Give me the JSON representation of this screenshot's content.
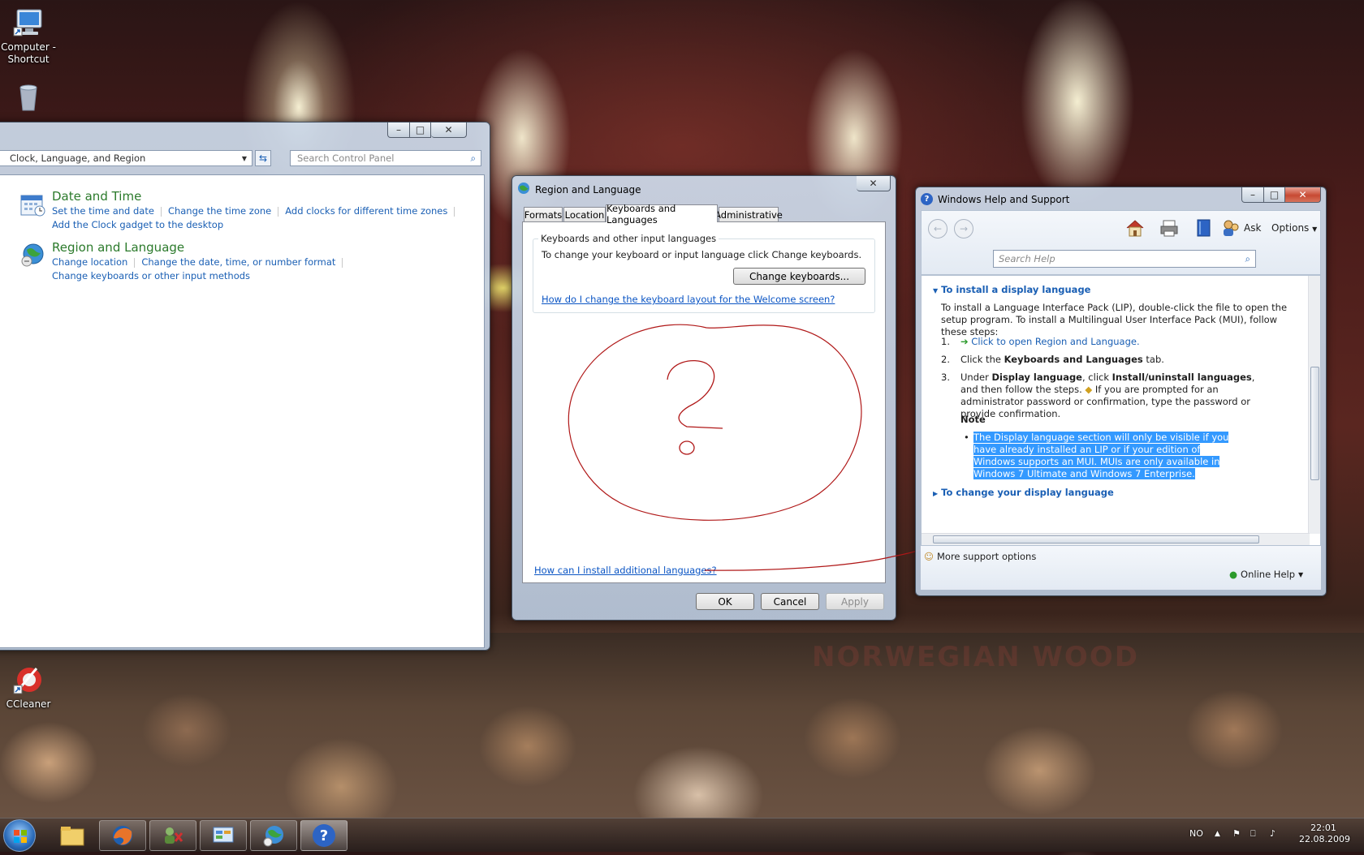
{
  "desktop": {
    "icons": [
      {
        "label_line1": "Computer -",
        "label_line2": "Shortcut"
      },
      {
        "label": "Recycle Bin"
      },
      {
        "label": "CCleaner"
      }
    ],
    "stage_text": "NORWEGIAN WOOD"
  },
  "control_panel": {
    "address": "Clock, Language, and Region",
    "search_placeholder": "Search Control Panel",
    "sections": [
      {
        "title": "Date and Time",
        "links_row1": [
          "Set the time and date",
          "Change the time zone",
          "Add clocks for different time zones"
        ],
        "links_row2": [
          "Add the Clock gadget to the desktop"
        ]
      },
      {
        "title": "Region and Language",
        "links_row1": [
          "Change location",
          "Change the date, time, or number format"
        ],
        "links_row2": [
          "Change keyboards or other input methods"
        ]
      }
    ]
  },
  "region_dialog": {
    "title": "Region and Language",
    "tabs": [
      "Formats",
      "Location",
      "Keyboards and Languages",
      "Administrative"
    ],
    "active_tab": "Keyboards and Languages",
    "group_title": "Keyboards and other input languages",
    "group_text": "To change your keyboard or input language click Change keyboards.",
    "change_button": "Change keyboards...",
    "welcome_link": "How do I change the keyboard layout for the Welcome screen?",
    "install_link": "How can I install additional languages?",
    "annotation": "?",
    "ok": "OK",
    "cancel": "Cancel",
    "apply": "Apply"
  },
  "help_window": {
    "title": "Windows Help and Support",
    "ask": "Ask",
    "options": "Options",
    "search_placeholder": "Search Help",
    "section1_title": "To install a display language",
    "intro": "To install a Language Interface Pack (LIP), double-click the file to open the setup program. To install a Multilingual User Interface Pack (MUI), follow these steps:",
    "steps": [
      {
        "num": "1.",
        "text": "Click to open Region and Language."
      },
      {
        "num": "2.",
        "pre": "Click the ",
        "bold": "Keyboards and Languages",
        "post": " tab."
      },
      {
        "num": "3.",
        "pre": "Under ",
        "bold": "Display language",
        "mid": ", click ",
        "bold2": "Install/uninstall languages",
        "post": ", and then follow the steps.",
        "rest": " If you are prompted for an administrator password or confirmation, type the password or provide confirmation."
      }
    ],
    "note_label": "Note",
    "note_text": "The Display language section will only be visible if you have already installed an LIP or if your edition of Windows supports an MUI. MUIs are only available in Windows 7 Ultimate and Windows 7 Enterprise.",
    "section2_title": "To change your display language",
    "more_support": "More support options",
    "online_help": "Online Help"
  },
  "taskbar": {
    "language": "NO",
    "time": "22:01",
    "date": "22.08.2009"
  },
  "colors": {
    "link": "#1a5fb4",
    "cp_heading": "#2b7a2b",
    "selection": "#3399ff",
    "annotation_red": "#b01818"
  }
}
